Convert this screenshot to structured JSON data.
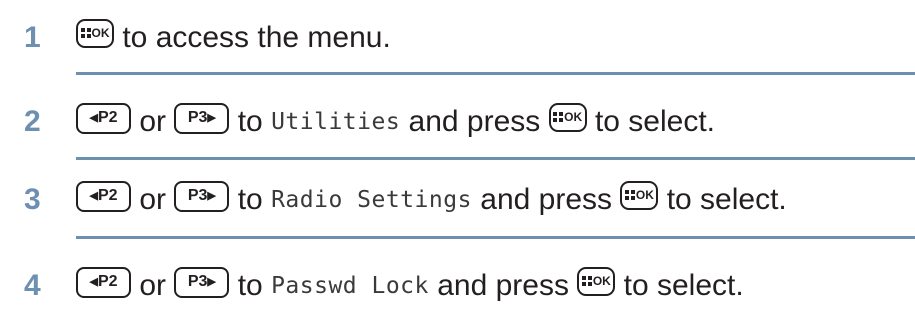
{
  "steps": [
    {
      "number": "1",
      "parts": [
        {
          "type": "key",
          "key": "menu_ok"
        },
        {
          "type": "text",
          "text": " to access the menu."
        }
      ]
    },
    {
      "number": "2",
      "parts": [
        {
          "type": "key",
          "key": "p2_left"
        },
        {
          "type": "text",
          "text": " or "
        },
        {
          "type": "key",
          "key": "p3_right"
        },
        {
          "type": "text",
          "text": " to "
        },
        {
          "type": "mono",
          "text": "Utilities"
        },
        {
          "type": "text",
          "text": " and press "
        },
        {
          "type": "key",
          "key": "menu_ok"
        },
        {
          "type": "text",
          "text": " to select."
        }
      ]
    },
    {
      "number": "3",
      "parts": [
        {
          "type": "key",
          "key": "p2_left"
        },
        {
          "type": "text",
          "text": " or "
        },
        {
          "type": "key",
          "key": "p3_right"
        },
        {
          "type": "text",
          "text": " to "
        },
        {
          "type": "mono",
          "text": "Radio Settings"
        },
        {
          "type": "text",
          "text": " and press "
        },
        {
          "type": "key",
          "key": "menu_ok"
        },
        {
          "type": "text",
          "text": " to select."
        }
      ]
    },
    {
      "number": "4",
      "parts": [
        {
          "type": "key",
          "key": "p2_left"
        },
        {
          "type": "text",
          "text": " or "
        },
        {
          "type": "key",
          "key": "p3_right"
        },
        {
          "type": "text",
          "text": " to "
        },
        {
          "type": "mono",
          "text": "Passwd Lock"
        },
        {
          "type": "text",
          "text": " and press "
        },
        {
          "type": "key",
          "key": "menu_ok"
        },
        {
          "type": "text",
          "text": " to select."
        }
      ]
    }
  ],
  "keys": {
    "menu_ok": {
      "label": "OK",
      "icon": "menu-grid-icon"
    },
    "p2_left": {
      "label": "P2",
      "arrow": "◀",
      "icon": "left-triangle-icon"
    },
    "p3_right": {
      "label": "P3",
      "arrow": "▶",
      "icon": "right-triangle-icon"
    }
  },
  "colors": {
    "step_number": "#6d8fb0",
    "divider": "#6d8fb0",
    "text": "#231f20"
  }
}
